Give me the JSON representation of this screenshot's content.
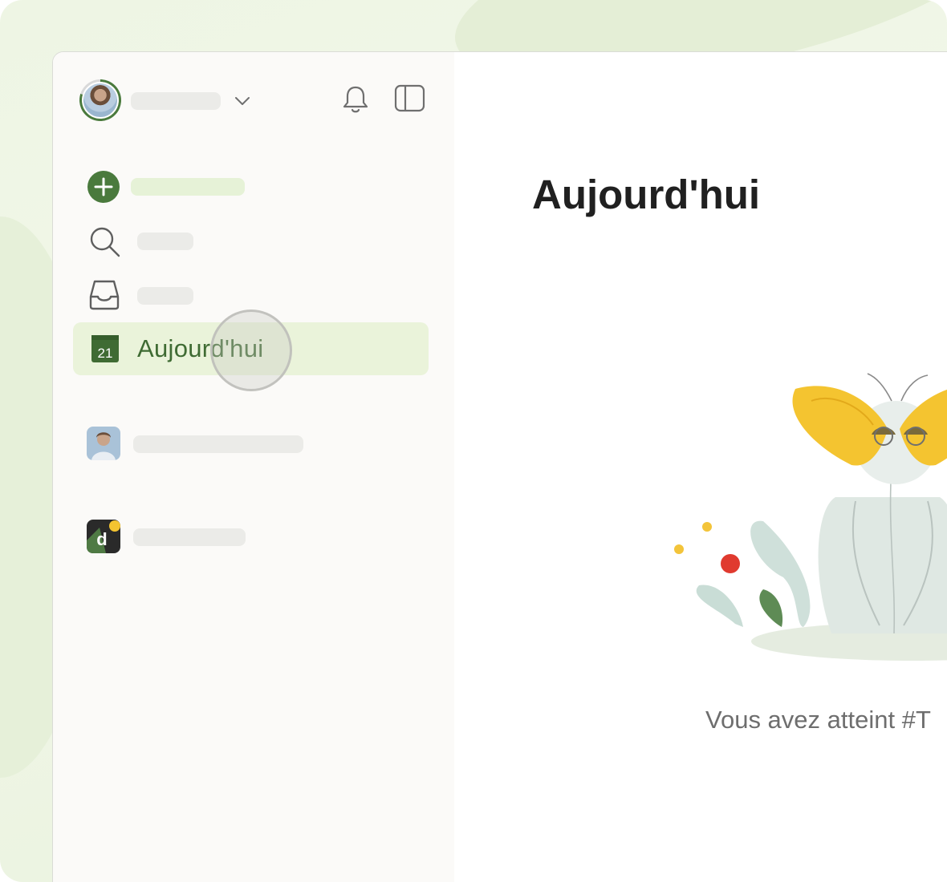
{
  "app": {
    "title": "Aujourd'hui"
  },
  "sidebar": {
    "items": [
      {
        "label": "Aujourd'hui",
        "icon": "calendar-today-icon",
        "day": "21",
        "active": true
      }
    ],
    "icons": {
      "add_task": "plus-circle-icon",
      "search": "search-icon",
      "inbox": "inbox-icon",
      "notifications": "bell-icon",
      "toggle_sidebar": "sidebar-toggle-icon"
    }
  },
  "main": {
    "title": "Aujourd'hui",
    "empty_state_text": "Vous avez atteint #T"
  },
  "colors": {
    "accent": "#4a7a3d",
    "active_bg": "#eaf3da",
    "sidebar_bg": "#fbfaf8",
    "text": "#202020"
  }
}
